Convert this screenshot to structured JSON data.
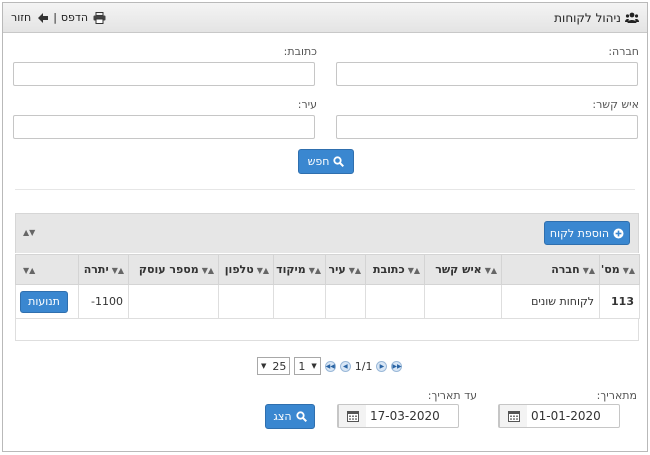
{
  "header": {
    "title": "ניהול לקוחות",
    "print_label": "הדפס",
    "back_label": "חזור",
    "separator": "|"
  },
  "search": {
    "company_label": "חברה:",
    "address_label": "כתובת:",
    "contact_label": "איש קשר:",
    "city_label": "עיר:",
    "company_value": "",
    "address_value": "",
    "contact_value": "",
    "city_value": "",
    "search_button": "חפש"
  },
  "toolbar": {
    "add_customer_button": "הוספת לקוח"
  },
  "table": {
    "columns": [
      "מס'",
      "חברה",
      "איש קשר",
      "כתובת",
      "עיר",
      "מיקוד",
      "טלפון",
      "מספר עוסק",
      "יתרה",
      ""
    ],
    "rows": [
      {
        "num": "113",
        "company": "לקוחות שונים",
        "contact": "",
        "address": "",
        "city": "",
        "zip": "",
        "phone": "",
        "business_id": "",
        "balance": "1100-",
        "action": "תנועות"
      }
    ]
  },
  "pager": {
    "page_size": "25",
    "page": "1",
    "page_info": "1/1"
  },
  "dates": {
    "from_label": "מתאריך:",
    "from_value": "01-01-2020",
    "to_label": "עד תאריך:",
    "to_value": "17-03-2020",
    "show_button": "הצג"
  },
  "colors": {
    "button": "#3a87d0",
    "header_bg": "#e6e6e6"
  }
}
